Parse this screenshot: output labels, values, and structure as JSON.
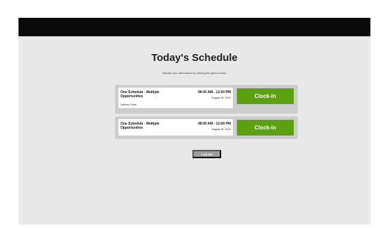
{
  "page": {
    "title": "Today's Schedule",
    "subtitle": "Indicate your attendance by clicking the green button."
  },
  "schedules": [
    {
      "name": "One Schedule - Multiple Opportunities",
      "role": "Delivery Driver",
      "time": "08:00 AM - 12:00 PM",
      "date": "August 28, 2023",
      "button_label": "Clock-In"
    },
    {
      "name": "One Schedule - Multiple Opportunities",
      "time": "08:00 AM - 12:00 PM",
      "date": "August 28, 2023",
      "button_label": "Clock-In"
    }
  ],
  "logout_label": "Log out",
  "colors": {
    "topbar": "#0a0a0a",
    "background": "#e8e8e8",
    "clockin": "#5ba112",
    "logout": "#9e9e9e"
  }
}
